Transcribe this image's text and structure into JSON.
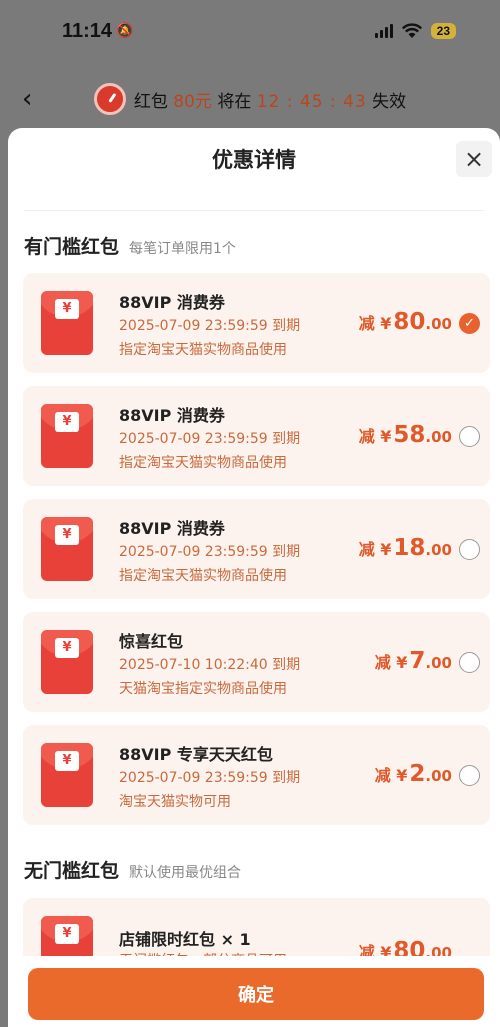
{
  "status_bar": {
    "time": "11:14",
    "battery": "23"
  },
  "header": {
    "banner_prefix": "红包",
    "banner_amount": "80元",
    "banner_middle": "将在",
    "countdown": "12 : 45 : 43",
    "banner_suffix": "失效"
  },
  "sheet": {
    "title": "优惠详情",
    "close_label": "×"
  },
  "threshold_section": {
    "title": "有门槛红包",
    "subtitle": "每笔订单限用1个",
    "coupons": [
      {
        "name": "88VIP 消费券",
        "expire": "2025-07-09 23:59:59 到期",
        "scope": "指定淘宝天猫实物商品使用",
        "prefix": "减 ¥",
        "amount_int": "80",
        "amount_dec": ".00",
        "selected": true
      },
      {
        "name": "88VIP 消费券",
        "expire": "2025-07-09 23:59:59 到期",
        "scope": "指定淘宝天猫实物商品使用",
        "prefix": "减 ¥",
        "amount_int": "58",
        "amount_dec": ".00",
        "selected": false
      },
      {
        "name": "88VIP 消费券",
        "expire": "2025-07-09 23:59:59 到期",
        "scope": "指定淘宝天猫实物商品使用",
        "prefix": "减 ¥",
        "amount_int": "18",
        "amount_dec": ".00",
        "selected": false
      },
      {
        "name": "惊喜红包",
        "expire": "2025-07-10 10:22:40 到期",
        "scope": "天猫淘宝指定实物商品使用",
        "prefix": "减 ¥",
        "amount_int": "7",
        "amount_dec": ".00",
        "selected": false
      },
      {
        "name": "88VIP 专享天天红包",
        "expire": "2025-07-09 23:59:59 到期",
        "scope": "淘宝天猫实物可用",
        "prefix": "减 ¥",
        "amount_int": "2",
        "amount_dec": ".00",
        "selected": false
      }
    ]
  },
  "no_threshold_section": {
    "title": "无门槛红包",
    "subtitle": "默认使用最优组合",
    "coupons": [
      {
        "name": "店铺限时红包 × 1",
        "scope": "无门槛红包，部分商品可用",
        "prefix": "减 ¥",
        "amount_int": "80",
        "amount_dec": ".00"
      }
    ]
  },
  "footer": {
    "confirm_label": "确定"
  },
  "colors": {
    "accent": "#ea6a2c",
    "envelope": "#e8413a",
    "card_bg": "#fdf3ee"
  }
}
